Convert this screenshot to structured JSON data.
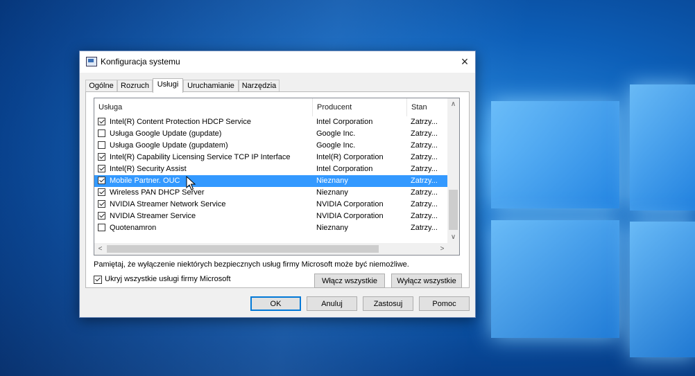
{
  "desktop": {
    "accent": "#0d5fb8"
  },
  "window": {
    "title": "Konfiguracja systemu",
    "close_icon": "×"
  },
  "tabs": [
    {
      "label": "Ogólne"
    },
    {
      "label": "Rozruch"
    },
    {
      "label": "Usługi",
      "active": true
    },
    {
      "label": "Uruchamianie"
    },
    {
      "label": "Narzędzia"
    }
  ],
  "services_table": {
    "headers": [
      "Usługa",
      "Producent",
      "Stan"
    ],
    "rows": [
      {
        "checked": true,
        "name": "Intel(R) Content Protection HDCP Service",
        "maker": "Intel Corporation",
        "status": "Zatrzy..."
      },
      {
        "checked": false,
        "name": "Usługa Google Update (gupdate)",
        "maker": "Google Inc.",
        "status": "Zatrzy..."
      },
      {
        "checked": false,
        "name": "Usługa Google Update (gupdatem)",
        "maker": "Google Inc.",
        "status": "Zatrzy..."
      },
      {
        "checked": true,
        "name": "Intel(R) Capability Licensing Service TCP IP Interface",
        "maker": "Intel(R) Corporation",
        "status": "Zatrzy..."
      },
      {
        "checked": true,
        "name": "Intel(R) Security Assist",
        "maker": "Intel Corporation",
        "status": "Zatrzy..."
      },
      {
        "checked": true,
        "name": "Mobile Partner. OUC",
        "maker": "Nieznany",
        "status": "Zatrzy...",
        "selected": true
      },
      {
        "checked": true,
        "name": "Wireless PAN DHCP Server",
        "maker": "Nieznany",
        "status": "Zatrzy..."
      },
      {
        "checked": true,
        "name": "NVIDIA Streamer Network Service",
        "maker": "NVIDIA Corporation",
        "status": "Zatrzy..."
      },
      {
        "checked": true,
        "name": "NVIDIA Streamer Service",
        "maker": "NVIDIA Corporation",
        "status": "Zatrzy..."
      },
      {
        "checked": false,
        "name": "Quotenamron",
        "maker": "Nieznany",
        "status": "Zatrzy..."
      }
    ],
    "selection_color": "#3399ff"
  },
  "note": "Pamiętaj, że wyłączenie niektórych bezpiecznych usług firmy Microsoft może być niemożliwe.",
  "hide_ms": {
    "label": "Ukryj wszystkie usługi firmy Microsoft",
    "checked": true
  },
  "buttons": {
    "enable_all": "Włącz wszystkie",
    "disable_all": "Wyłącz wszystkie",
    "ok": "OK",
    "cancel": "Anuluj",
    "apply": "Zastosuj",
    "help": "Pomoc"
  }
}
